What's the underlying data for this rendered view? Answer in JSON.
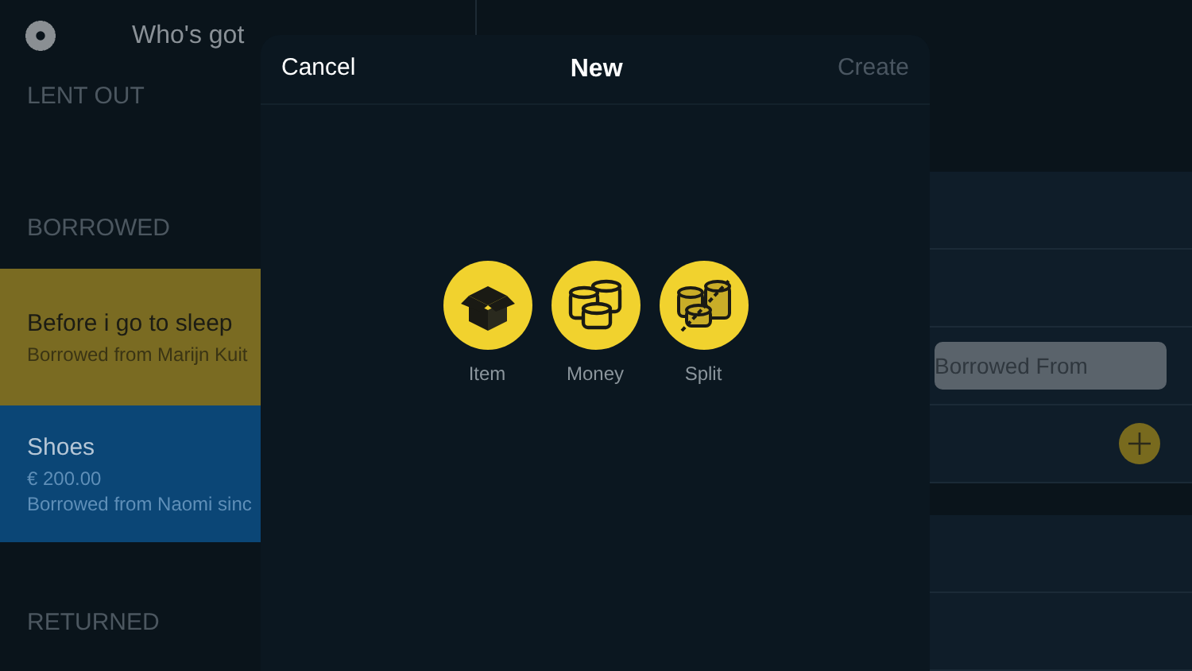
{
  "master": {
    "title": "Who's got",
    "sections": [
      {
        "title": "LENT OUT"
      },
      {
        "title": "BORROWED",
        "items": [
          {
            "title": "Before i go to sleep",
            "lines": [
              "Borrowed from Marijn Kuit"
            ],
            "color": "#7a6b22"
          },
          {
            "title": "Shoes",
            "lines": [
              "€ 200.00",
              "Borrowed from Naomi sinc"
            ],
            "color": "#0b4676"
          }
        ]
      },
      {
        "title": "RETURNED"
      }
    ]
  },
  "detail": {
    "field": {
      "placeholder": "Borrowed From"
    }
  },
  "modal": {
    "cancel": "Cancel",
    "title": "New",
    "create": {
      "label": "Create",
      "disabled": true
    },
    "options": [
      {
        "kind": "item",
        "label": "Item"
      },
      {
        "kind": "money",
        "label": "Money"
      },
      {
        "kind": "split",
        "label": "Split"
      }
    ]
  }
}
